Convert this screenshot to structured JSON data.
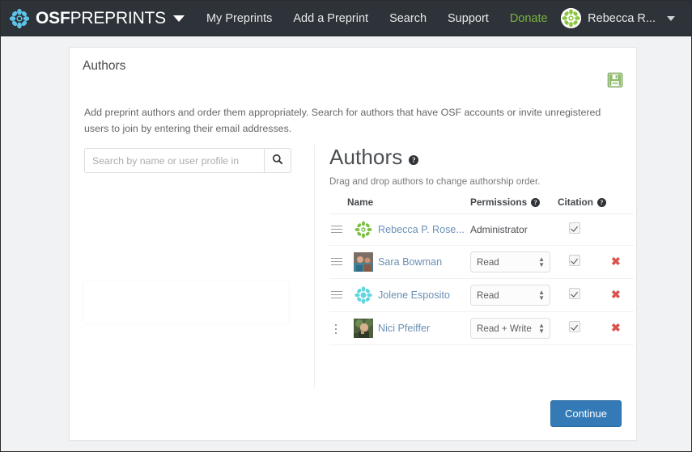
{
  "navbar": {
    "brand_strong": "OSF",
    "brand_thin": "PREPRINTS",
    "logo_icon": "osf-flower-logo-icon",
    "brand_caret_icon": "caret-down-icon",
    "links": [
      {
        "label": "My Preprints",
        "name": "nav-my-preprints"
      },
      {
        "label": "Add a Preprint",
        "name": "nav-add-a-preprint"
      },
      {
        "label": "Search",
        "name": "nav-search"
      },
      {
        "label": "Support",
        "name": "nav-support"
      },
      {
        "label": "Donate",
        "name": "nav-donate"
      }
    ],
    "donate_color": "#7cb342",
    "user": {
      "label": "Rebecca R...",
      "avatar_icon": "user-avatar-identicon",
      "caret_icon": "caret-down-icon"
    },
    "background": "#2d3338"
  },
  "card": {
    "title": "Authors",
    "save_icon": "save-floppy-disk-icon",
    "save_icon_color": "#77a355",
    "intro": "Add preprint authors and order them appropriately. Search for authors that have OSF accounts or invite unregistered users to join by entering their email addresses.",
    "continue_label": "Continue",
    "continue_color": "#337ab7"
  },
  "search": {
    "placeholder": "Search by name or user profile in",
    "value": "",
    "button_icon": "search-icon",
    "button_name": "search-button"
  },
  "authors_panel": {
    "heading": "Authors",
    "heading_help_icon": "question-mark-help-icon",
    "drag_hint": "Drag and drop authors to change authorship order.",
    "columns": {
      "name": "Name",
      "permissions": "Permissions",
      "permissions_help_icon": "question-mark-help-icon",
      "citation": "Citation",
      "citation_help_icon": "question-mark-help-icon"
    },
    "permission_options": [
      "Read",
      "Read + Write",
      "Administrator"
    ],
    "rows": [
      {
        "handle_icon": "drag-handle-icon",
        "avatar_icon": "osf-identicon-avatar",
        "name": "Rebecca P. Rose...",
        "permission": "Administrator",
        "permission_editable": false,
        "citation_checked": true,
        "removable": false,
        "remove_icon": ""
      },
      {
        "handle_icon": "drag-handle-icon",
        "avatar_icon": "photo-avatar",
        "name": "Sara Bowman",
        "permission": "Read",
        "permission_editable": true,
        "citation_checked": true,
        "removable": true,
        "remove_icon": "remove-x-icon"
      },
      {
        "handle_icon": "drag-handle-icon",
        "avatar_icon": "cyan-identicon-avatar",
        "name": "Jolene Esposito",
        "permission": "Read",
        "permission_editable": true,
        "citation_checked": true,
        "removable": true,
        "remove_icon": "remove-x-icon"
      },
      {
        "handle_icon": "drag-handle-dots-icon",
        "avatar_icon": "photo-avatar",
        "name": "Nici Pfeiffer",
        "permission": "Read + Write",
        "permission_editable": true,
        "citation_checked": true,
        "removable": true,
        "remove_icon": "remove-x-icon"
      }
    ]
  },
  "drop_zone": {
    "name": "author-drop-zone",
    "label": ""
  }
}
